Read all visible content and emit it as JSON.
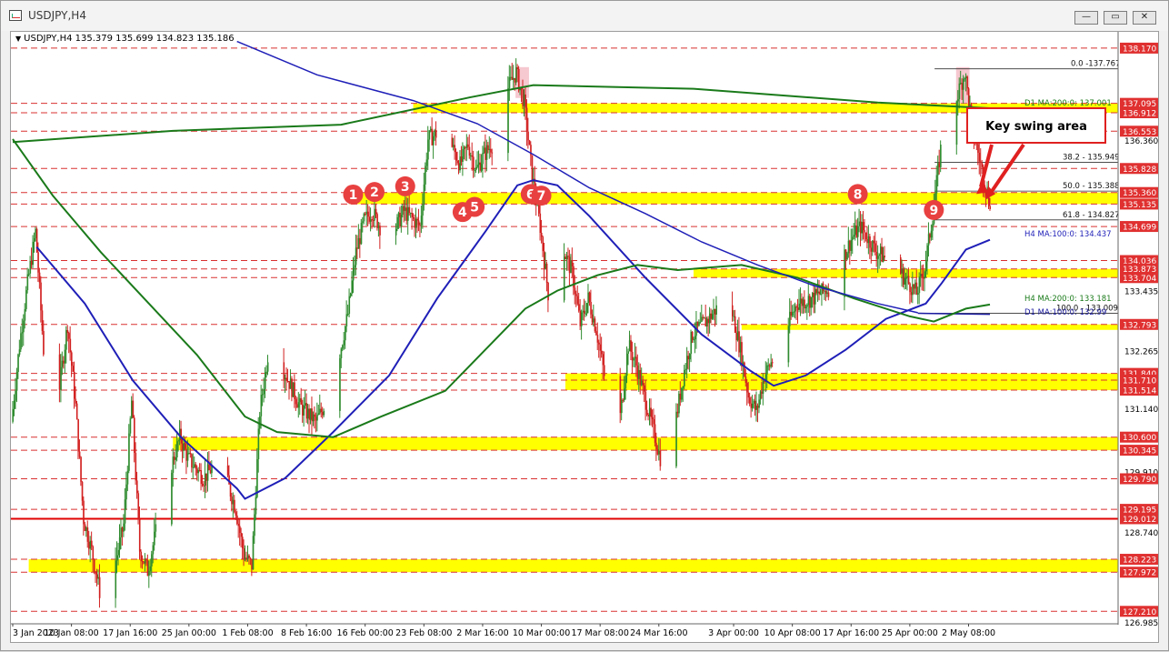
{
  "window": {
    "title": "USDJPY,H4",
    "buttons": {
      "minimize": "—",
      "maximize": "▭",
      "close": "✕"
    }
  },
  "header": {
    "symbol": "USDJPY,H4",
    "ohlc": "135.379 135.699 134.823 135.186"
  },
  "colors": {
    "up_candle": "#2e8b2e",
    "down_candle": "#d22020",
    "zone": "#ffff00",
    "ma100": "#1f1fb8",
    "ma200": "#1a7a1a",
    "d1_ma100": "#1a1aa0",
    "hline_dashed": "#d93030",
    "hline_solid": "#e00000",
    "price_tag": "#e03030",
    "marker": "#e84040",
    "callout_border": "#e02020"
  },
  "annotations": {
    "callout_text": "Key swing area",
    "markers": [
      {
        "label": "1",
        "x": "2023-02-14 12:00",
        "y": 135.32
      },
      {
        "label": "2",
        "x": "2023-02-17 04:00",
        "y": 135.37
      },
      {
        "label": "3",
        "x": "2023-02-21 00:00",
        "y": 135.48
      },
      {
        "label": "4",
        "x": "2023-02-28 04:00",
        "y": 134.98
      },
      {
        "label": "5",
        "x": "2023-03-01 16:00",
        "y": 135.08
      },
      {
        "label": "6",
        "x": "2023-03-08 16:00",
        "y": 135.33
      },
      {
        "label": "7",
        "x": "2023-03-10 00:00",
        "y": 135.3
      },
      {
        "label": "8",
        "x": "2023-04-18 12:00",
        "y": 135.33
      },
      {
        "label": "9",
        "x": "2023-04-28 00:00",
        "y": 135.02
      }
    ],
    "fib_labels": [
      "0.0 -137.767",
      "38.2 - 135.949",
      "50.0 - 135.388",
      "61.8 - 134.827",
      "100.0 - 133.009"
    ],
    "ma_labels": [
      "D1 MA:200:0: 137.001",
      "H4 MA:100:0: 134.437",
      "H4 MA:200:0: 133.181",
      "D1 MA:100:0: 132.99"
    ]
  },
  "chart_data": {
    "type": "candlestick",
    "symbol": "USDJPY",
    "timeframe": "H4",
    "ylim": [
      126.985,
      138.31
    ],
    "y_ticks": [
      136.36,
      135.828,
      135.36,
      135.135,
      134.699,
      134.036,
      133.873,
      133.704,
      133.435,
      132.793,
      132.265,
      131.84,
      131.71,
      131.514,
      131.14,
      130.6,
      130.345,
      129.91,
      129.79,
      129.195,
      129.012,
      128.74,
      128.223,
      127.972,
      127.21,
      126.985
    ],
    "x_ticks": [
      "3 Jan 2023",
      "10 Jan 08:00",
      "17 Jan 16:00",
      "25 Jan 00:00",
      "1 Feb 08:00",
      "8 Feb 16:00",
      "16 Feb 00:00",
      "23 Feb 08:00",
      "2 Mar 16:00",
      "10 Mar 00:00",
      "17 Mar 08:00",
      "24 Mar 16:00",
      "3 Apr 00:00",
      "10 Apr 08:00",
      "17 Apr 16:00",
      "25 Apr 00:00",
      "2 May 08:00"
    ],
    "key_levels": [
      138.17,
      137.095,
      136.912,
      136.553,
      135.828,
      135.36,
      135.135,
      134.699,
      134.036,
      133.873,
      133.704,
      132.793,
      131.84,
      131.71,
      131.514,
      130.6,
      130.345,
      129.79,
      129.195,
      129.012,
      128.223,
      127.972,
      127.21
    ],
    "zones": [
      {
        "from": "2023-02-22",
        "to": "2023-05-05",
        "low": 136.912,
        "high": 137.095
      },
      {
        "from": "2023-02-14",
        "to": "2023-05-05",
        "low": 135.135,
        "high": 135.36
      },
      {
        "from": "2023-03-29",
        "to": "2023-05-05",
        "low": 133.704,
        "high": 133.873
      },
      {
        "from": "2023-04-04",
        "to": "2023-05-05",
        "low": 132.72,
        "high": 132.793
      },
      {
        "from": "2023-03-13",
        "to": "2023-05-05",
        "low": 131.514,
        "high": 131.84
      },
      {
        "from": "2023-01-23",
        "to": "2023-05-05",
        "low": 130.345,
        "high": 130.6
      },
      {
        "from": "2023-01-05",
        "to": "2023-05-05",
        "low": 127.972,
        "high": 128.223
      }
    ],
    "fibonacci": {
      "high": 137.767,
      "low": 133.009,
      "levels": [
        {
          "label": "0.0",
          "value": 137.767
        },
        {
          "label": "38.2",
          "value": 135.949
        },
        {
          "label": "50.0",
          "value": 135.388
        },
        {
          "label": "61.8",
          "value": 134.827
        },
        {
          "label": "100.0",
          "value": 133.009
        }
      ]
    },
    "moving_averages": [
      {
        "name": "D1 MA:200:0",
        "last": 137.001,
        "points": [
          [
            "2023-01-03",
            136.34
          ],
          [
            "2023-01-23",
            136.56
          ],
          [
            "2023-02-13",
            136.68
          ],
          [
            "2023-03-01",
            137.21
          ],
          [
            "2023-03-09",
            137.45
          ],
          [
            "2023-03-29",
            137.38
          ],
          [
            "2023-04-21",
            137.11
          ],
          [
            "2023-05-05",
            137.0
          ]
        ]
      },
      {
        "name": "D1 MA:100:0",
        "last": 132.99,
        "points": [
          [
            "2023-04-26",
            133.01
          ],
          [
            "2023-05-05",
            132.99
          ]
        ]
      },
      {
        "name": "H4 MA:100:0",
        "last": 134.437,
        "points": [
          [
            "2023-01-06",
            134.3
          ],
          [
            "2023-01-12",
            133.2
          ],
          [
            "2023-01-18",
            131.7
          ],
          [
            "2023-01-24",
            130.6
          ],
          [
            "2023-01-31",
            129.6
          ],
          [
            "2023-02-01",
            129.4
          ],
          [
            "2023-02-06",
            129.8
          ],
          [
            "2023-02-12",
            130.7
          ],
          [
            "2023-02-19",
            131.8
          ],
          [
            "2023-02-25",
            133.3
          ],
          [
            "2023-03-03",
            134.6
          ],
          [
            "2023-03-07",
            135.5
          ],
          [
            "2023-03-09",
            135.6
          ],
          [
            "2023-03-12",
            135.5
          ],
          [
            "2023-03-16",
            134.9
          ],
          [
            "2023-03-23",
            133.7
          ],
          [
            "2023-03-30",
            132.6
          ],
          [
            "2023-04-05",
            131.9
          ],
          [
            "2023-04-08",
            131.6
          ],
          [
            "2023-04-12",
            131.8
          ],
          [
            "2023-04-17",
            132.3
          ],
          [
            "2023-04-22",
            132.9
          ],
          [
            "2023-04-27",
            133.2
          ],
          [
            "2023-04-29",
            133.6
          ],
          [
            "2023-05-02",
            134.25
          ],
          [
            "2023-05-05",
            134.44
          ]
        ]
      },
      {
        "name": "H4 MA:200:0",
        "last": 133.181,
        "points": [
          [
            "2023-01-03",
            136.4
          ],
          [
            "2023-01-08",
            135.3
          ],
          [
            "2023-01-14",
            134.2
          ],
          [
            "2023-01-20",
            133.2
          ],
          [
            "2023-01-26",
            132.2
          ],
          [
            "2023-02-01",
            131.0
          ],
          [
            "2023-02-05",
            130.7
          ],
          [
            "2023-02-12",
            130.6
          ],
          [
            "2023-02-18",
            131.0
          ],
          [
            "2023-02-26",
            131.5
          ],
          [
            "2023-03-03",
            132.3
          ],
          [
            "2023-03-08",
            133.1
          ],
          [
            "2023-03-12",
            133.45
          ],
          [
            "2023-03-17",
            133.75
          ],
          [
            "2023-03-22",
            133.95
          ],
          [
            "2023-03-27",
            133.85
          ],
          [
            "2023-04-04",
            133.95
          ],
          [
            "2023-04-11",
            133.7
          ],
          [
            "2023-04-18",
            133.3
          ],
          [
            "2023-04-25",
            132.95
          ],
          [
            "2023-04-28",
            132.85
          ],
          [
            "2023-05-02",
            133.1
          ],
          [
            "2023-05-05",
            133.18
          ]
        ]
      },
      {
        "name": "D1 MA:100 (steep)",
        "points": [
          [
            "2023-01-31",
            138.3
          ],
          [
            "2023-02-10",
            137.65
          ],
          [
            "2023-02-22",
            137.15
          ],
          [
            "2023-03-02",
            136.7
          ],
          [
            "2023-03-09",
            136.1
          ],
          [
            "2023-03-16",
            135.45
          ],
          [
            "2023-03-23",
            134.95
          ],
          [
            "2023-03-30",
            134.4
          ],
          [
            "2023-04-06",
            133.95
          ],
          [
            "2023-04-13",
            133.55
          ],
          [
            "2023-04-21",
            133.2
          ],
          [
            "2023-04-26",
            133.02
          ]
        ]
      }
    ],
    "price_path": [
      [
        "2023-01-03",
        130.9
      ],
      [
        "2023-01-04",
        132.4
      ],
      [
        "2023-01-05",
        133.6
      ],
      [
        "2023-01-06",
        134.6
      ],
      [
        "2023-01-07",
        132.3
      ],
      [
        "2023-01-09",
        131.6
      ],
      [
        "2023-01-10",
        132.8
      ],
      [
        "2023-01-11",
        131.2
      ],
      [
        "2023-01-12",
        129.0
      ],
      [
        "2023-01-13",
        128.4
      ],
      [
        "2023-01-14",
        127.6
      ],
      [
        "2023-01-15",
        128.6
      ],
      [
        "2023-01-16",
        128.2
      ],
      [
        "2023-01-17",
        128.9
      ],
      [
        "2023-01-18",
        131.3
      ],
      [
        "2023-01-19",
        128.4
      ],
      [
        "2023-01-20",
        128.0
      ],
      [
        "2023-01-22",
        129.5
      ],
      [
        "2023-01-24",
        130.6
      ],
      [
        "2023-01-25",
        130.2
      ],
      [
        "2023-01-27",
        129.8
      ],
      [
        "2023-01-29",
        130.2
      ],
      [
        "2023-01-31",
        129.2
      ],
      [
        "2023-02-01",
        128.3
      ],
      [
        "2023-02-02",
        128.1
      ],
      [
        "2023-02-03",
        131.1
      ],
      [
        "2023-02-04",
        132.2
      ],
      [
        "2023-02-06",
        131.9
      ],
      [
        "2023-02-08",
        131.2
      ],
      [
        "2023-02-10",
        130.9
      ],
      [
        "2023-02-12",
        131.5
      ],
      [
        "2023-02-14",
        133.0
      ],
      [
        "2023-02-15",
        134.2
      ],
      [
        "2023-02-16",
        134.8
      ],
      [
        "2023-02-17",
        135.0
      ],
      [
        "2023-02-19",
        134.4
      ],
      [
        "2023-02-21",
        135.0
      ],
      [
        "2023-02-23",
        134.7
      ],
      [
        "2023-02-24",
        136.4
      ],
      [
        "2023-02-26",
        136.6
      ],
      [
        "2023-02-28",
        135.9
      ],
      [
        "2023-03-01",
        136.3
      ],
      [
        "2023-03-02",
        135.8
      ],
      [
        "2023-03-03",
        136.1
      ],
      [
        "2023-03-05",
        136.5
      ],
      [
        "2023-03-06",
        137.4
      ],
      [
        "2023-03-07",
        137.7
      ],
      [
        "2023-03-08",
        137.1
      ],
      [
        "2023-03-09",
        135.7
      ],
      [
        "2023-03-10",
        134.7
      ],
      [
        "2023-03-11",
        133.4
      ],
      [
        "2023-03-12",
        133.9
      ],
      [
        "2023-03-13",
        134.2
      ],
      [
        "2023-03-14",
        133.8
      ],
      [
        "2023-03-15",
        132.8
      ],
      [
        "2023-03-16",
        133.3
      ],
      [
        "2023-03-17",
        132.7
      ],
      [
        "2023-03-18",
        131.8
      ],
      [
        "2023-03-20",
        131.0
      ],
      [
        "2023-03-21",
        132.4
      ],
      [
        "2023-03-22",
        132.0
      ],
      [
        "2023-03-23",
        131.4
      ],
      [
        "2023-03-24",
        130.8
      ],
      [
        "2023-03-25",
        130.2
      ],
      [
        "2023-03-27",
        131.0
      ],
      [
        "2023-03-28",
        131.9
      ],
      [
        "2023-03-29",
        132.6
      ],
      [
        "2023-03-31",
        132.9
      ],
      [
        "2023-04-01",
        133.1
      ],
      [
        "2023-04-03",
        133.0
      ],
      [
        "2023-04-04",
        132.3
      ],
      [
        "2023-04-05",
        131.4
      ],
      [
        "2023-04-06",
        131.1
      ],
      [
        "2023-04-07",
        131.8
      ],
      [
        "2023-04-09",
        132.4
      ],
      [
        "2023-04-11",
        133.2
      ],
      [
        "2023-04-13",
        133.3
      ],
      [
        "2023-04-15",
        133.5
      ],
      [
        "2023-04-16",
        133.8
      ],
      [
        "2023-04-18",
        134.5
      ],
      [
        "2023-04-19",
        134.7
      ],
      [
        "2023-04-21",
        134.2
      ],
      [
        "2023-04-23",
        134.0
      ],
      [
        "2023-04-25",
        133.6
      ],
      [
        "2023-04-26",
        133.4
      ],
      [
        "2023-04-27",
        133.9
      ],
      [
        "2023-04-28",
        134.9
      ],
      [
        "2023-04-29",
        136.2
      ],
      [
        "2023-04-30",
        136.6
      ],
      [
        "2023-05-01",
        137.2
      ],
      [
        "2023-05-02",
        137.7
      ],
      [
        "2023-05-03",
        136.6
      ],
      [
        "2023-05-04",
        135.9
      ],
      [
        "2023-05-05",
        135.2
      ]
    ],
    "peak_highlights": [
      {
        "from": "2023-03-07",
        "to": "2023-03-08",
        "low": 137.2,
        "high": 137.8
      },
      {
        "from": "2023-05-01",
        "to": "2023-05-02",
        "low": 137.1,
        "high": 137.8
      }
    ],
    "red_line": 129.012
  }
}
